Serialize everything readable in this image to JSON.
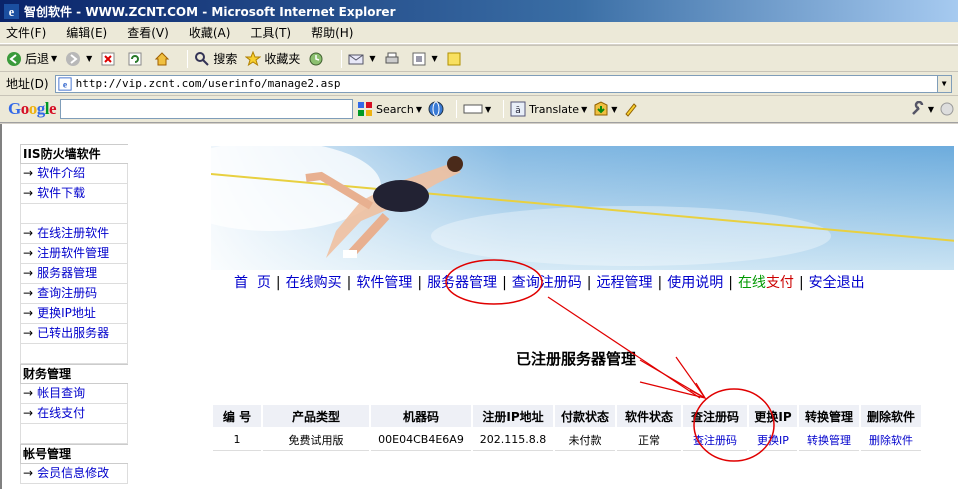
{
  "window": {
    "title": "智创软件 - WWW.ZCNT.COM - Microsoft Internet Explorer"
  },
  "menu": [
    "文件(F)",
    "编辑(E)",
    "查看(V)",
    "收藏(A)",
    "工具(T)",
    "帮助(H)"
  ],
  "toolbar": {
    "back": "后退",
    "search": "搜索",
    "favorites": "收藏夹"
  },
  "address": {
    "label": "地址(D)",
    "url": "http://vip.zcnt.com/userinfo/manage2.asp"
  },
  "googlebar": {
    "logo": "Google",
    "search_btn": "Search",
    "translate_btn": "Translate"
  },
  "sidebar": {
    "sections": [
      {
        "title": "IIS防火墙软件",
        "items": [
          "软件介绍",
          "软件下载"
        ]
      },
      {
        "title": "",
        "items": [
          "在线注册软件",
          "注册软件管理",
          "服务器管理",
          "查询注册码",
          "更换IP地址",
          "已转出服务器"
        ]
      },
      {
        "title": "财务管理",
        "items": [
          "帐目查询",
          "在线支付"
        ]
      },
      {
        "title": "帐号管理",
        "items": [
          "会员信息修改"
        ]
      }
    ],
    "arrow": "→"
  },
  "nav": {
    "items": [
      "首  页",
      "在线购买",
      "软件管理",
      "服务器管理",
      "查询注册码",
      "远程管理",
      "使用说明"
    ],
    "pay_part1": "在线",
    "pay_part2": "支付",
    "logout": "安全退出",
    "separator": "|"
  },
  "heading": "已注册服务器管理",
  "table": {
    "headers": [
      "编 号",
      "产品类型",
      "机器码",
      "注册IP地址",
      "付款状态",
      "软件状态",
      "查注册码",
      "更换IP",
      "转换管理",
      "删除软件"
    ],
    "rows": [
      [
        "1",
        "免费试用版",
        "00E04CB4E6A9",
        "202.115.8.8",
        "未付款",
        "正常",
        "查注册码",
        "更换IP",
        "转换管理",
        "删除软件"
      ]
    ]
  },
  "colors": {
    "link": "#0000cc",
    "annotation": "#e00000",
    "header_bg": "#eef0f6"
  }
}
